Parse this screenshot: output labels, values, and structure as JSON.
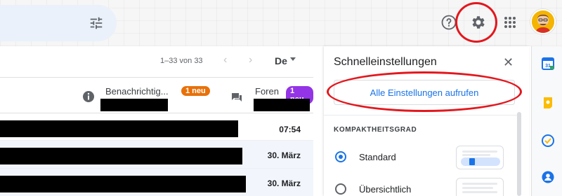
{
  "header": {
    "search_tune_icon": "tune-icon",
    "help_icon": "help-circle-icon",
    "settings_icon": "gear-icon",
    "apps_icon": "apps-grid-icon",
    "avatar": "avatar"
  },
  "toolbar": {
    "paging": "1–33 von 33",
    "lang": "De"
  },
  "mail": {
    "tabs": [
      {
        "label": "Benachrichtig...",
        "badge": "1 neu",
        "badge_color": "#e8710a"
      },
      {
        "label": "Foren",
        "badge": "1 neu",
        "badge_color": "#9334e6"
      }
    ],
    "rows": [
      {
        "date": "07:54"
      },
      {
        "date": "30. März"
      },
      {
        "date": "30. März"
      }
    ]
  },
  "quick_settings": {
    "title": "Schnelleinstellungen",
    "all_settings_label": "Alle Einstellungen aufrufen",
    "density_heading": "KOMPAKTHEITSGRAD",
    "options": [
      {
        "label": "Standard",
        "selected": true
      },
      {
        "label": "Übersichtlich",
        "selected": false
      }
    ]
  },
  "accents": {
    "primary": "#1a73e8",
    "annotation": "#e3171d"
  }
}
